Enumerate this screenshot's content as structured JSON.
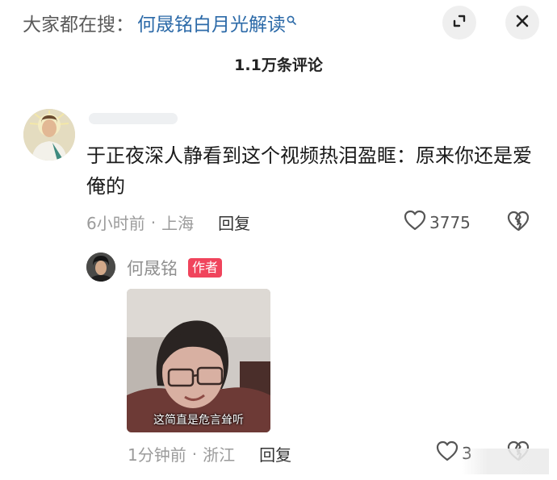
{
  "search": {
    "prefix": "大家都在搜：",
    "query": "何晟铭白月光解读"
  },
  "header": {
    "comment_count": "1.1万条评论"
  },
  "comment": {
    "text": "于正夜深人静看到这个视频热泪盈眶：原来你还是爱俺的",
    "time": "6小时前",
    "separator": "·",
    "location": "上海",
    "reply_label": "回复",
    "likes": "3775"
  },
  "reply": {
    "username": "何晟铭",
    "badge": "作者",
    "image_caption": "这简直是危言耸听",
    "time": "1分钟前",
    "separator": "·",
    "location": "浙江",
    "reply_label": "回复",
    "likes": "3"
  },
  "colors": {
    "query": "#2c6aa8",
    "badge": "#f0445c",
    "meta": "#9b9b9b"
  }
}
